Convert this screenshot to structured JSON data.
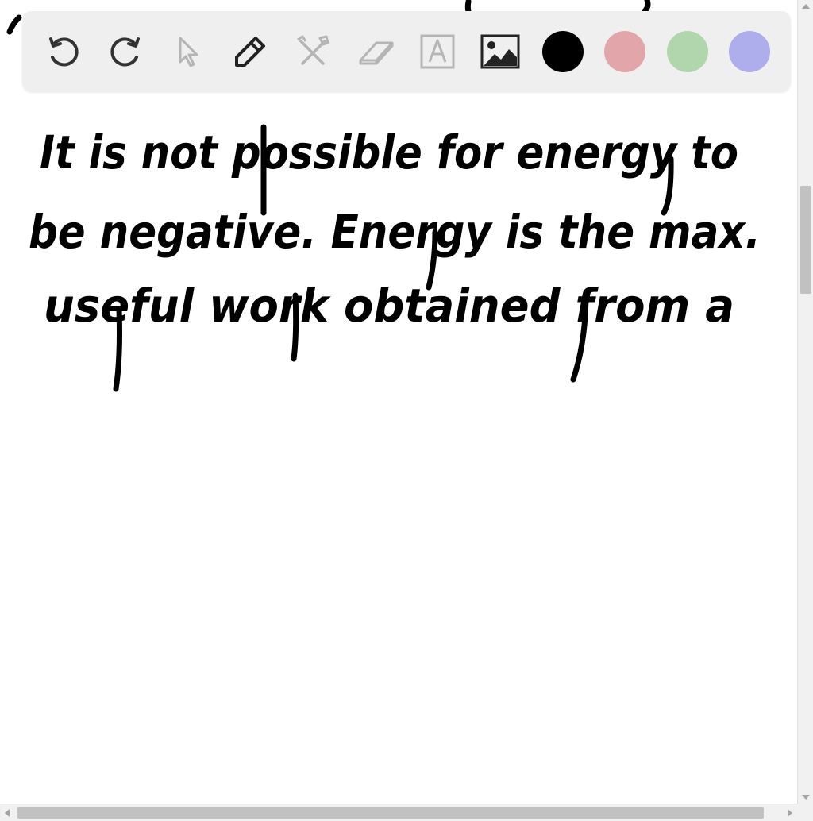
{
  "handwriting": {
    "line1": "It is not possible for energy to",
    "line2": "be negative. Energy is the max.",
    "line3": "useful work obtained from a"
  },
  "toolbar": {
    "tools": [
      {
        "name": "undo",
        "icon": "undo-icon"
      },
      {
        "name": "redo",
        "icon": "redo-icon"
      },
      {
        "name": "select",
        "icon": "pointer-icon"
      },
      {
        "name": "pen",
        "icon": "pencil-icon"
      },
      {
        "name": "tools",
        "icon": "crossed-tools-icon"
      },
      {
        "name": "eraser",
        "icon": "eraser-icon"
      },
      {
        "name": "text",
        "icon": "text-box-icon"
      },
      {
        "name": "image",
        "icon": "image-icon"
      }
    ],
    "colors": [
      "#000000",
      "#e2a6aa",
      "#b1d5ad",
      "#aeaeec"
    ]
  }
}
